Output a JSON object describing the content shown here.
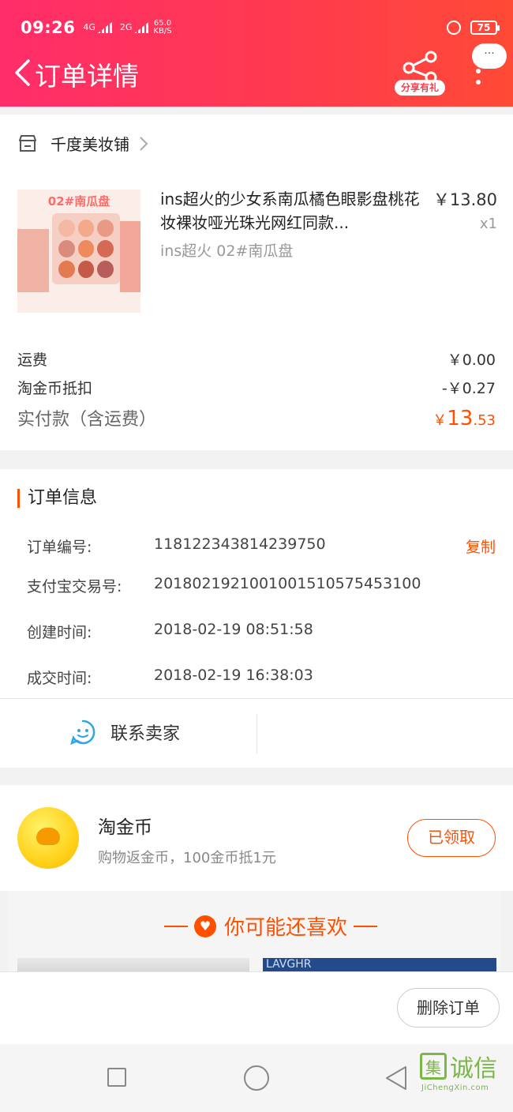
{
  "status_bar": {
    "time": "09:26",
    "network_1": "4G",
    "network_2": "2G",
    "speed_value": "65.0",
    "speed_unit": "KB/S",
    "battery": "75"
  },
  "header": {
    "title": "订单详情",
    "share_label": "分享有礼",
    "more_label": "···"
  },
  "order": {
    "shop_name": "千度美妆铺",
    "product": {
      "title": "ins超火的少女系南瓜橘色眼影盘桃花妆裸妆哑光珠光网红同款...",
      "price": "￥13.80",
      "quantity": "x1",
      "sku": "ins超火 02#南瓜盘",
      "image_label": "02#南瓜盘"
    },
    "fees": [
      {
        "label": "运费",
        "value": "￥0.00"
      },
      {
        "label": "淘金币抵扣",
        "value": "-￥0.27"
      }
    ],
    "pay": {
      "label": "实付款（含运费）",
      "currency": "￥",
      "integer": "13",
      "decimal": ".53"
    }
  },
  "order_info": {
    "section_title": "订单信息",
    "rows": [
      {
        "key": "订单编号:",
        "value": "118122343814239750",
        "action": "复制"
      },
      {
        "key": "支付宝交易号:",
        "value": "2018021921001001510575453100"
      },
      {
        "key": "创建时间:",
        "value": "2018-02-19 08:51:58"
      },
      {
        "key": "成交时间:",
        "value": "2018-02-19 16:38:03"
      }
    ],
    "contact_label": "联系卖家"
  },
  "coin": {
    "title": "淘金币",
    "desc": "购物返金币，100金币抵1元",
    "button": "已领取"
  },
  "recommend": {
    "title": "你可能还喜欢",
    "item2_text": "LAVGHR"
  },
  "bottom": {
    "delete_button": "删除订单"
  },
  "watermark": {
    "char1": "集",
    "chars": "诚信",
    "url": "JiChengXin.com"
  },
  "colors": {
    "header_start": "#ff2d6a",
    "header_end": "#ff4a36",
    "accent": "#ff5000",
    "contact_icon": "#2ea7e0"
  }
}
